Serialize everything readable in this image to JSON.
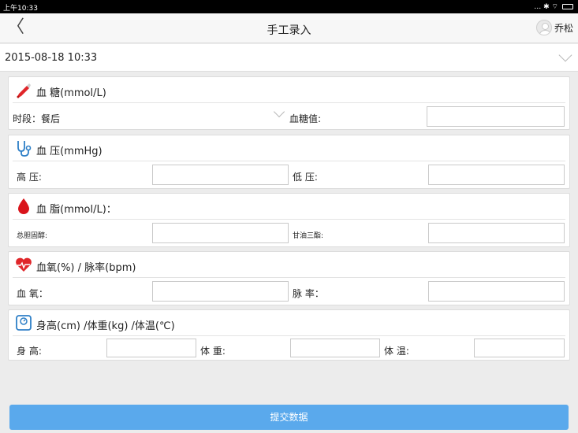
{
  "status_bar": {
    "time": "上午10:33",
    "icons": "… ✱ ⌔"
  },
  "header": {
    "back_label": "〈",
    "title": "手工录入",
    "user_name": "乔松"
  },
  "date_selector": {
    "value": "2015-08-18 10:33"
  },
  "blood_sugar": {
    "label": "血 糖(mmol/L)",
    "period_label": "时段：餐后",
    "value_label": "血糖值:",
    "value": ""
  },
  "blood_pressure": {
    "label": "血 压(mmHg)",
    "high_label": "高 压:",
    "high_value": "",
    "low_label": "低 压:",
    "low_value": ""
  },
  "blood_lipid": {
    "label": "血 脂(mmol/L)：",
    "cholesterol_label": "总胆固醇:",
    "cholesterol_value": "",
    "triglyceride_label": "甘油三酯:",
    "triglyceride_value": ""
  },
  "oxygen_pulse": {
    "label": "血氧(%) / 脉率(bpm)",
    "oxygen_label": "血 氧：",
    "oxygen_value": "",
    "pulse_label": "脉 率：",
    "pulse_value": ""
  },
  "body": {
    "label": "身高(cm) /体重(kg) /体温(℃)",
    "height_label": "身 高:",
    "height_value": "",
    "weight_label": "体 重:",
    "weight_value": "",
    "temp_label": "体 温:",
    "temp_value": ""
  },
  "submit_label": "提交数据",
  "colors": {
    "accent": "#5aa9ec",
    "heart_red": "#e0262a",
    "drop_red": "#d9141b",
    "icon_blue": "#2e7fc7"
  }
}
